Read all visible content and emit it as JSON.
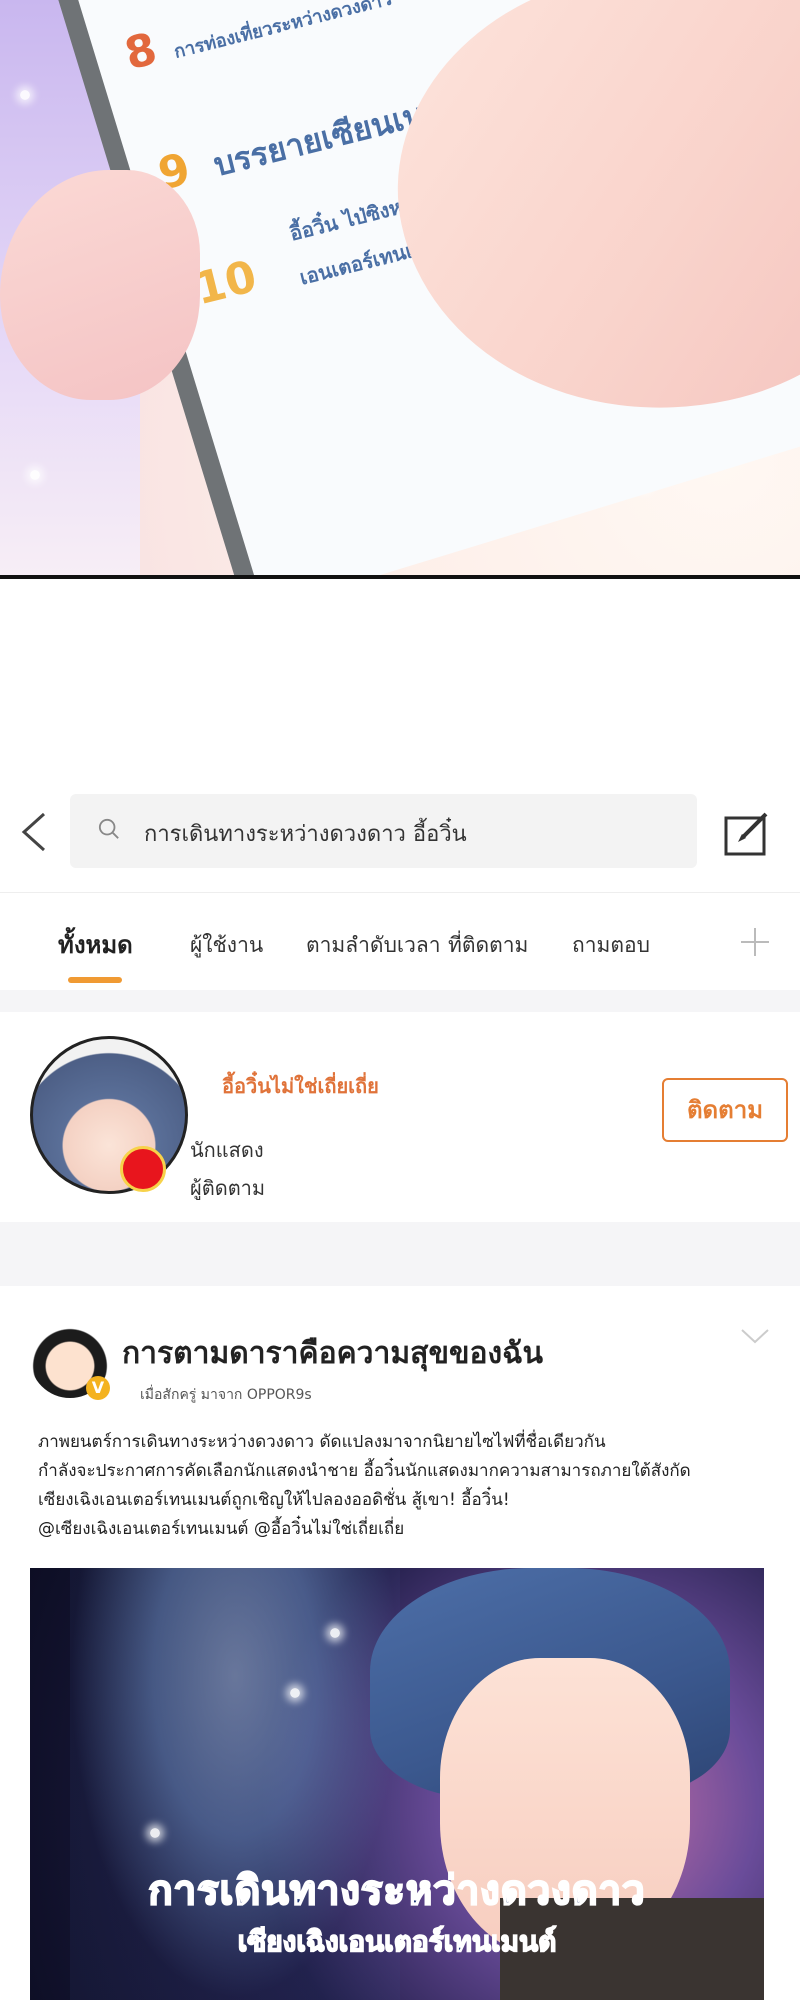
{
  "comic_panel": {
    "ranking": [
      {
        "number": "8",
        "text": "การท่องเที่ยวระหว่างดวงดาว",
        "color": "#e2683d"
      },
      {
        "number": "9",
        "text": "บรรยายเซียนเบาๆ",
        "color": "#f0a533"
      },
      {
        "number": "10",
        "text": "อี้อวิ๋น ไป่ซิงหวาง",
        "text2": "เอนเตอร์เทนเมนต์",
        "color": "#f2b64a"
      }
    ]
  },
  "header": {
    "search_query": "การเดินทางระหว่างดวงดาว อี้อวิ๋น"
  },
  "tabs": [
    {
      "label": "ทั้งหมด"
    },
    {
      "label": "ผู้ใช้งาน"
    },
    {
      "label": "ตามลำดับเวลา"
    },
    {
      "label": "ที่ติดตาม"
    },
    {
      "label": "ถามตอบ"
    }
  ],
  "user_card": {
    "name": "อี้อวิ๋นไม่ใช่เถี่ยเถี่ย",
    "role": "นักแสดง",
    "followers_label": "ผู้ติดตาม",
    "follow_label": "ติดตาม"
  },
  "post": {
    "title": "การตามดาราคือความสุขของฉัน",
    "meta": "เมื่อสักครู่  มาจาก OPPOR9s",
    "verified_mark": "V",
    "body": [
      "ภาพยนตร์การเดินทางระหว่างดวงดาว ดัดแปลงมาจากนิยายไซไฟที่ชื่อเดียวกัน",
      "กำลังจะประกาศการคัดเลือกนักแสดงนำชาย อี้อวิ๋นนักแสดงมากความสามารถภายใต้สังกัด",
      "เซียงเฉิงเอนเตอร์เทนเมนต์ถูกเชิญให้ไปลองออดิชั่น สู้เขา! อี้อวิ๋น!",
      "@เซียงเฉิงเอนเตอร์เทนเมนต์ @อี้อวิ๋นไม่ใช่เถี่ยเถี่ย"
    ],
    "image_title": "การเดินทางระหว่างดวงดาว",
    "image_subtitle": "เซียงเฉิงเอนเตอร์เทนเมนต์"
  },
  "colors": {
    "accent": "#f09a33",
    "follow": "#e57e33",
    "name": "#e0733a"
  }
}
